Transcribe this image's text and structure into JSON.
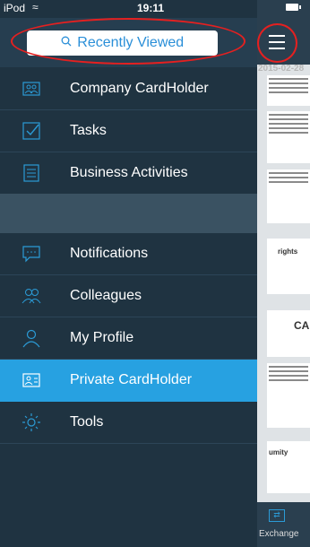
{
  "status": {
    "carrier": "iPod",
    "time": "19:11"
  },
  "search": {
    "label": "Recently Viewed",
    "icon": "search-icon"
  },
  "menu": {
    "group1": [
      {
        "label": "Company CardHolder",
        "icon": "company-cardholder-icon"
      },
      {
        "label": "Tasks",
        "icon": "tasks-icon"
      },
      {
        "label": "Business Activities",
        "icon": "business-activities-icon"
      }
    ],
    "group2": [
      {
        "label": "Notifications",
        "icon": "notifications-icon"
      },
      {
        "label": "Colleagues",
        "icon": "colleagues-icon"
      },
      {
        "label": "My Profile",
        "icon": "my-profile-icon"
      },
      {
        "label": "Private CardHolder",
        "icon": "private-cardholder-icon",
        "active": true
      },
      {
        "label": "Tools",
        "icon": "tools-icon"
      }
    ]
  },
  "right_panel": {
    "date": "2015-02-28",
    "exchange_label": "Exchange",
    "cards": [
      "rights",
      "CA",
      "umity"
    ]
  },
  "colors": {
    "accent": "#27a1e1",
    "menu_bg": "#1f3341",
    "highlight": "#e52020"
  }
}
